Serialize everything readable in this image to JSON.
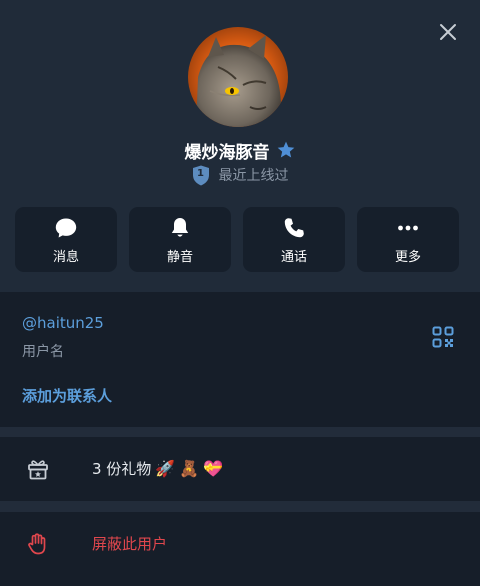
{
  "profile": {
    "name": "爆炒海豚音",
    "status": "最近上线过",
    "level_badge": "1"
  },
  "actions": [
    {
      "label": "消息",
      "icon": "chat-bubble-icon"
    },
    {
      "label": "静音",
      "icon": "bell-icon"
    },
    {
      "label": "通话",
      "icon": "phone-icon"
    },
    {
      "label": "更多",
      "icon": "more-dots-icon"
    }
  ],
  "info": {
    "username": "@haitun25",
    "username_caption": "用户名",
    "add_contact": "添加为联系人"
  },
  "gifts": {
    "label": "3 份礼物",
    "emojis": [
      "🚀",
      "🧸",
      "💝"
    ]
  },
  "block": {
    "label": "屏蔽此用户"
  },
  "colors": {
    "accent": "#5c9fdc",
    "danger": "#e0474d",
    "header_bg": "#202b39",
    "body_bg": "#161e29"
  }
}
